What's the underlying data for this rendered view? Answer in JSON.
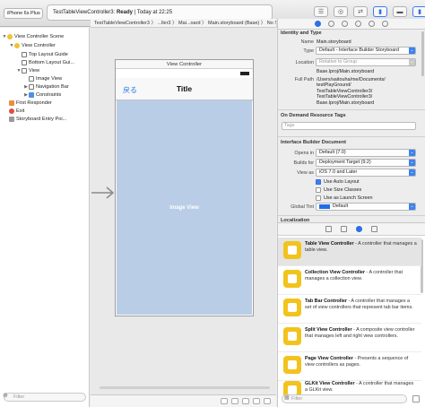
{
  "toolbar": {
    "scheme": "iPhone 6s Plus",
    "activity_project": "TestTableViewController3:",
    "activity_status": "Ready",
    "activity_time": "| Today at 22:25"
  },
  "pathbar": {
    "text": "TestTableViewController3 〉 ...ller3 〉 Mai...oard 〉 Main.storyboard (Base) 〉 No Selection"
  },
  "navigator": {
    "items": [
      {
        "label": "View Controller Scene",
        "icon": "scene-icon"
      },
      {
        "label": "View Controller",
        "icon": "view-controller-icon"
      },
      {
        "label": "Top Layout Guide",
        "icon": "layout-guide-icon"
      },
      {
        "label": "Bottom Layout Gui...",
        "icon": "layout-guide-icon"
      },
      {
        "label": "View",
        "icon": "view-icon"
      },
      {
        "label": "Image View",
        "icon": "image-view-icon"
      },
      {
        "label": "Navigation Bar",
        "icon": "navigation-bar-icon"
      },
      {
        "label": "Constraints",
        "icon": "constraints-icon"
      },
      {
        "label": "First Responder",
        "icon": "first-responder-icon"
      },
      {
        "label": "Exit",
        "icon": "exit-icon"
      },
      {
        "label": "Storyboard Entry Poi...",
        "icon": "entry-point-icon"
      }
    ],
    "filter_placeholder": "Filter"
  },
  "canvas": {
    "scene_title": "View Controller",
    "back_button": "戻る",
    "nav_title": "Title",
    "image_view_label": "Image View"
  },
  "inspector": {
    "identity_header": "Identity and Type",
    "name_label": "Name",
    "name_value": "Main.storyboard",
    "type_label": "Type",
    "type_value": "Default - Interface Builder Storyboard",
    "location_label": "Location",
    "location_value": "Relative to Group",
    "location_file": "Base.lproj/Main.storyboard",
    "fullpath_label": "Full Path",
    "fullpath_value": "/Users/saitouha/me/Documents/\ntestPlayGround/\nTestTableViewController3/\nTestTableViewController3/\nBase.lproj/Main.storyboard",
    "odr_header": "On Demand Resource Tags",
    "tags_placeholder": "Tags",
    "ibdoc_header": "Interface Builder Document",
    "opens_in_label": "Opens in",
    "opens_in_value": "Default (7.0)",
    "builds_for_label": "Builds for",
    "builds_for_value": "Deployment Target (9.2)",
    "view_as_label": "View as",
    "view_as_value": "iOS 7.0 and Later",
    "use_auto_layout": "Use Auto Layout",
    "use_size_classes": "Use Size Classes",
    "use_launch_screen": "Use as Launch Screen",
    "global_tint_label": "Global Tint",
    "global_tint_value": "Default",
    "localization_header": "Localization"
  },
  "library": {
    "items": [
      {
        "title": "Table View Controller",
        "desc": " - A controller that manages a table view."
      },
      {
        "title": "Collection View Controller",
        "desc": " - A controller that manages a collection view."
      },
      {
        "title": "Tab Bar Controller",
        "desc": " - A controller that manages a set of view controllers that represent tab bar items."
      },
      {
        "title": "Split View Controller",
        "desc": " - A composite view controller that manages left and right view controllers."
      },
      {
        "title": "Page View Controller",
        "desc": " - Presents a sequence of view controllers as pages."
      },
      {
        "title": "GLKit View Controller",
        "desc": " - A controller that manages a GLKit view."
      }
    ],
    "filter_placeholder": "Filter"
  },
  "colors": {
    "accent": "#2f6fe0",
    "image_view_bg": "#b9cde6",
    "library_icon": "#f2c31c"
  }
}
